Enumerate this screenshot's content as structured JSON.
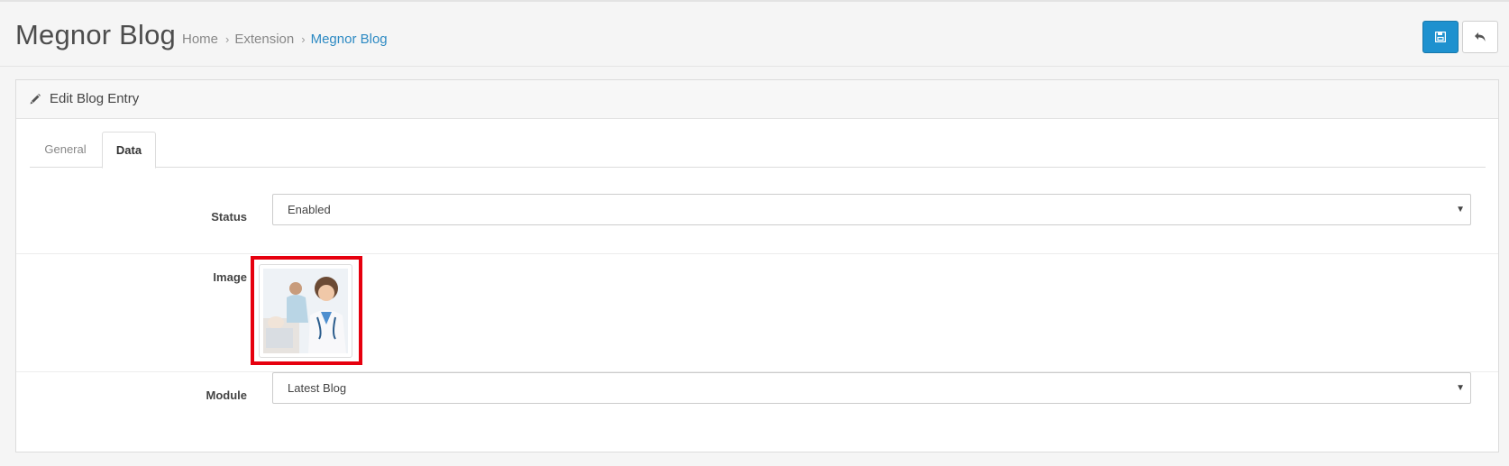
{
  "header": {
    "title": "Megnor Blog",
    "breadcrumb": [
      "Home",
      "Extension",
      "Megnor Blog"
    ],
    "breadcrumb_sep": "›",
    "save_icon": "floppy-disk-icon",
    "back_icon": "reply-icon"
  },
  "panel": {
    "title": "Edit Blog Entry",
    "icon": "pencil-icon"
  },
  "tabs": [
    "General",
    "Data"
  ],
  "active_tab": "Data",
  "form": {
    "status": {
      "label": "Status",
      "value": "Enabled"
    },
    "image": {
      "label": "Image"
    },
    "module": {
      "label": "Module",
      "value": "Latest Blog"
    }
  },
  "colors": {
    "primary": "#1e91cf",
    "link": "#2d8ac3",
    "highlight": "#e6000e"
  }
}
